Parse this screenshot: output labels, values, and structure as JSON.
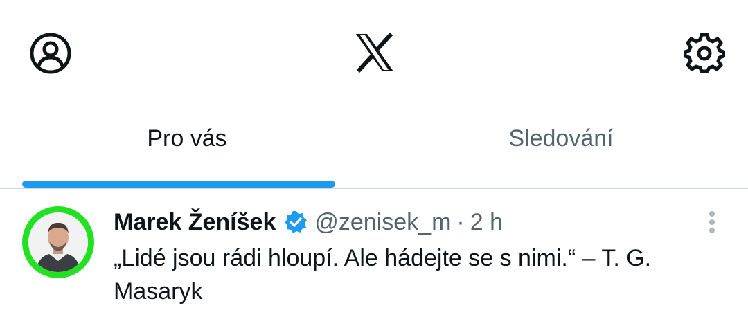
{
  "header": {
    "profile_icon": "user-circle-icon",
    "logo_icon": "x-logo-icon",
    "settings_icon": "gear-icon"
  },
  "tabs": [
    {
      "label": "Pro vás",
      "active": true
    },
    {
      "label": "Sledování",
      "active": false
    }
  ],
  "colors": {
    "accent": "#1d9bf0",
    "avatar_ring": "#22e022",
    "secondary_text": "#536471"
  },
  "tweet": {
    "author_name": "Marek Ženíšek",
    "verified": true,
    "handle": "@zenisek_m",
    "separator": "·",
    "time": "2 h",
    "text": "„Lidé jsou rádi hloupí. Ale hádejte se s nimi.“ – T. G. Masaryk",
    "more_icon": "more-vertical-icon"
  }
}
